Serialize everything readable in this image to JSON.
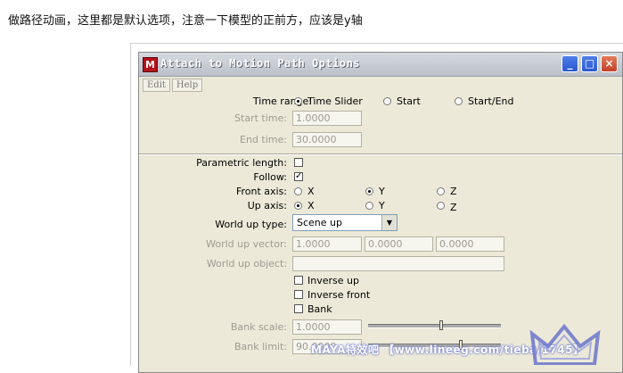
{
  "caption": "做路径动画，这里都是默认选项，注意一下模型的正前方，应该是y轴",
  "dialog": {
    "title": "Attach to Motion Path Options",
    "app_icon": "maya-icon",
    "buttons": {
      "minimize": "_",
      "maximize": "□",
      "close": "×"
    },
    "menu": [
      "Edit",
      "Help"
    ]
  },
  "time_range": {
    "label": "Time range:",
    "options": [
      "Time Slider",
      "Start",
      "Start/End"
    ],
    "selected": "Time Slider",
    "start_time_label": "Start time:",
    "start_time_value": "1.0000",
    "end_time_label": "End time:",
    "end_time_value": "30.0000"
  },
  "path": {
    "parametric_length_label": "Parametric length:",
    "parametric_length_checked": false,
    "follow_label": "Follow:",
    "follow_checked": true,
    "front_axis_label": "Front axis:",
    "front_axis_options": [
      "X",
      "Y",
      "Z"
    ],
    "front_axis_selected": "Y",
    "up_axis_label": "Up axis:",
    "up_axis_options": [
      "X",
      "Y",
      "Z"
    ],
    "up_axis_selected": "X",
    "world_up_type_label": "World up type:",
    "world_up_type_value": "Scene up",
    "world_up_vector_label": "World up vector:",
    "world_up_vector_values": [
      "1.0000",
      "0.0000",
      "0.0000"
    ],
    "world_up_object_label": "World up object:",
    "world_up_object_value": "",
    "inverse_up_label": "Inverse up",
    "inverse_front_label": "Inverse front",
    "bank_label": "Bank",
    "bank_scale_label": "Bank scale:",
    "bank_scale_value": "1.0000",
    "bank_scale_fraction": 0.55,
    "bank_limit_label": "Bank limit:",
    "bank_limit_value": "90.0000",
    "bank_limit_fraction": 0.7
  },
  "watermark": "MAYA特效吧 【www.lineeg.com/tieba/1745】",
  "colors": {
    "title_bar": "#c9ccd4",
    "dialog_bg": "#ece9d8",
    "close_button": "#c4412b",
    "xp_blue": "#2a58cf"
  }
}
